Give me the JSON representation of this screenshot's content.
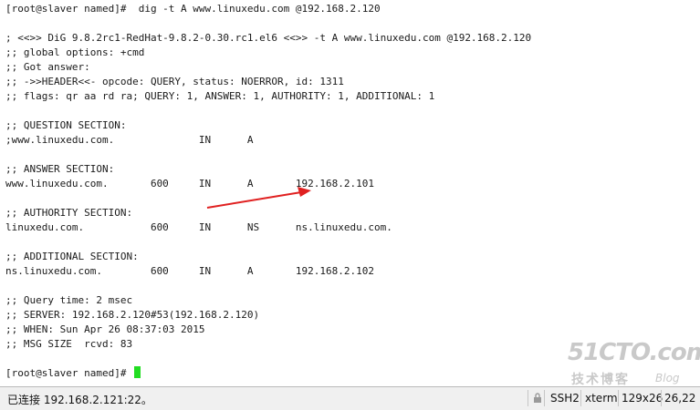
{
  "terminal": {
    "lines": [
      "[root@slaver named]#  dig -t A www.linuxedu.com @192.168.2.120",
      "",
      "; <<>> DiG 9.8.2rc1-RedHat-9.8.2-0.30.rc1.el6 <<>> -t A www.linuxedu.com @192.168.2.120",
      ";; global options: +cmd",
      ";; Got answer:",
      ";; ->>HEADER<<- opcode: QUERY, status: NOERROR, id: 1311",
      ";; flags: qr aa rd ra; QUERY: 1, ANSWER: 1, AUTHORITY: 1, ADDITIONAL: 1",
      "",
      ";; QUESTION SECTION:",
      ";www.linuxedu.com.              IN      A",
      "",
      ";; ANSWER SECTION:",
      "www.linuxedu.com.       600     IN      A       192.168.2.101",
      "",
      ";; AUTHORITY SECTION:",
      "linuxedu.com.           600     IN      NS      ns.linuxedu.com.",
      "",
      ";; ADDITIONAL SECTION:",
      "ns.linuxedu.com.        600     IN      A       192.168.2.102",
      "",
      ";; Query time: 2 msec",
      ";; SERVER: 192.168.2.120#53(192.168.2.120)",
      ";; WHEN: Sun Apr 26 08:37:03 2015",
      ";; MSG SIZE  rcvd: 83",
      "",
      "[root@slaver named]# "
    ]
  },
  "watermark": {
    "main": "51CTO.com",
    "sub": "技术博客",
    "blog": "Blog"
  },
  "status_bar": {
    "connection": "已连接 192.168.2.121:22。",
    "protocol": "SSH2",
    "terminal_type": "xterm",
    "size": "129x26",
    "cursor_pos": "26,22"
  },
  "colors": {
    "cursor": "#22dd22",
    "arrow": "#e02020",
    "watermark": "#c9c9c9"
  }
}
